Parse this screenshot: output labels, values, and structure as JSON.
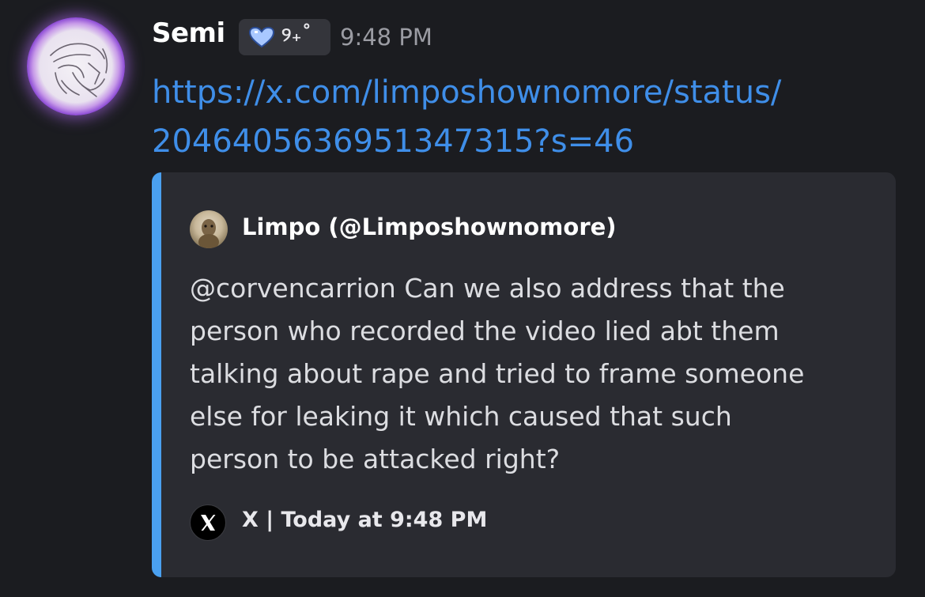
{
  "message": {
    "username": "Semi",
    "tag": {
      "icon": "heart-icon",
      "text": "୨₊˚"
    },
    "timestamp": "9:48 PM",
    "link_lines": [
      "https://x.com/limposhownomore/status/",
      "2046405636951347315?s=46"
    ]
  },
  "embed": {
    "accent_color": "#4aa0f0",
    "author": "Limpo (@Limposhownomore)",
    "text_lines": [
      "@corvencarrion Can we also address that the",
      "person who recorded the video lied abt them",
      "talking about rape and tried to frame someone",
      "else for leaking it which caused that such",
      "person to be attacked right?"
    ],
    "footer": {
      "icon": "x-logo-icon",
      "text": "X | Today at 9:48 PM"
    }
  }
}
